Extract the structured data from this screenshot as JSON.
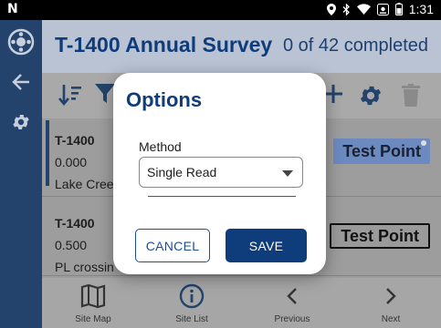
{
  "status_bar": {
    "brand_glyph": "N",
    "time": "1:31",
    "icons": [
      "location-icon",
      "bluetooth-icon",
      "wifi-icon",
      "nfc-icon",
      "battery-icon"
    ]
  },
  "rail": {
    "icons": [
      "app-menu-icon",
      "back-arrow-icon",
      "settings-icon"
    ]
  },
  "header": {
    "title": "T-1400 Annual Survey",
    "progress_text": "0 of 42 completed"
  },
  "toolbar": {
    "icons": [
      "sort-icon",
      "filter-icon",
      "add-icon",
      "settings-icon",
      "delete-icon"
    ]
  },
  "sites": [
    {
      "id": "T-1400",
      "value": "0.000",
      "location": "Lake Cree",
      "type": "Test Point"
    },
    {
      "id": "T-1400",
      "value": "0.500",
      "location": "PL crossin",
      "type": "Test Point"
    }
  ],
  "bottom_nav": {
    "items": [
      {
        "label": "Site Map",
        "icon": "map-icon"
      },
      {
        "label": "Site List",
        "icon": "info-icon"
      },
      {
        "label": "Previous",
        "icon": "chevron-left-icon"
      },
      {
        "label": "Next",
        "icon": "chevron-right-icon"
      }
    ]
  },
  "dialog": {
    "title": "Options",
    "method_label": "Method",
    "method_value": "Single Read",
    "cancel_label": "CANCEL",
    "save_label": "SAVE"
  },
  "colors": {
    "brand_navy": "#0f3c7a",
    "rail": "#23436c",
    "header_bg": "#b9c3d4",
    "pill_blue": "#6c8ac0"
  }
}
